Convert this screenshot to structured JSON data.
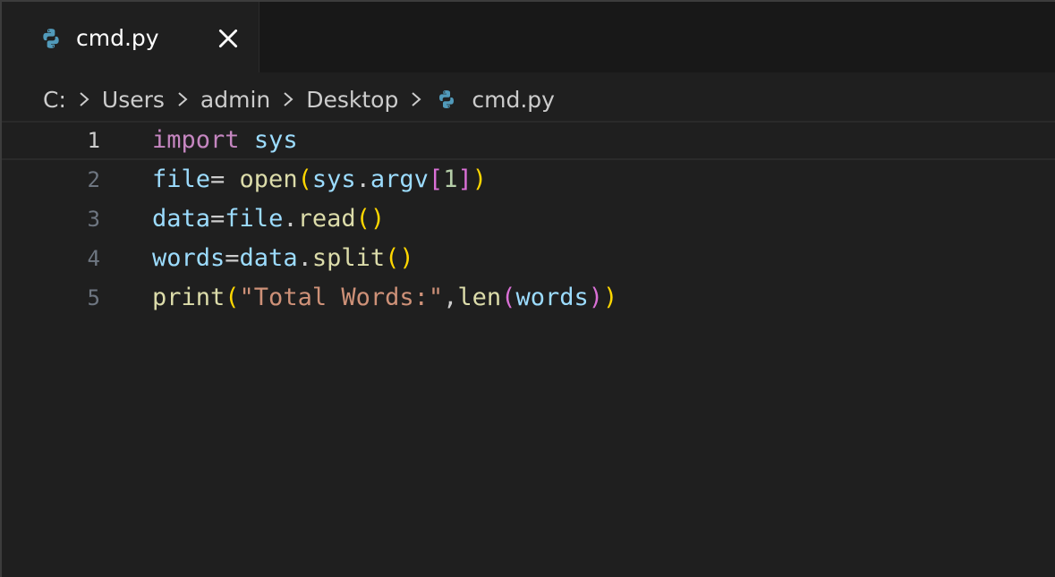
{
  "tab": {
    "label": "cmd.py",
    "icon": "python-file-icon",
    "close_icon": "close-icon"
  },
  "breadcrumb": {
    "items": [
      "C:",
      "Users",
      "admin",
      "Desktop",
      "cmd.py"
    ],
    "separator_icon": "chevron-right-icon",
    "file_icon": "python-file-icon"
  },
  "editor": {
    "current_line": 1,
    "lines": [
      {
        "number": "1",
        "tokens": [
          {
            "text": "import",
            "type": "keyword"
          },
          {
            "text": " ",
            "type": "plain"
          },
          {
            "text": "sys",
            "type": "variable"
          }
        ]
      },
      {
        "number": "2",
        "tokens": [
          {
            "text": "file",
            "type": "variable"
          },
          {
            "text": "= ",
            "type": "plain"
          },
          {
            "text": "open",
            "type": "function"
          },
          {
            "text": "(",
            "type": "bracket1"
          },
          {
            "text": "sys",
            "type": "variable"
          },
          {
            "text": ".",
            "type": "plain"
          },
          {
            "text": "argv",
            "type": "variable"
          },
          {
            "text": "[",
            "type": "bracket2"
          },
          {
            "text": "1",
            "type": "number"
          },
          {
            "text": "]",
            "type": "bracket2"
          },
          {
            "text": ")",
            "type": "bracket1"
          }
        ]
      },
      {
        "number": "3",
        "tokens": [
          {
            "text": "data",
            "type": "variable"
          },
          {
            "text": "=",
            "type": "plain"
          },
          {
            "text": "file",
            "type": "variable"
          },
          {
            "text": ".",
            "type": "plain"
          },
          {
            "text": "read",
            "type": "function"
          },
          {
            "text": "()",
            "type": "bracket1"
          }
        ]
      },
      {
        "number": "4",
        "tokens": [
          {
            "text": "words",
            "type": "variable"
          },
          {
            "text": "=",
            "type": "plain"
          },
          {
            "text": "data",
            "type": "variable"
          },
          {
            "text": ".",
            "type": "plain"
          },
          {
            "text": "split",
            "type": "function"
          },
          {
            "text": "()",
            "type": "bracket1"
          }
        ]
      },
      {
        "number": "5",
        "tokens": [
          {
            "text": "print",
            "type": "function"
          },
          {
            "text": "(",
            "type": "bracket1"
          },
          {
            "text": "\"Total Words:\"",
            "type": "string"
          },
          {
            "text": ",",
            "type": "plain"
          },
          {
            "text": "len",
            "type": "function"
          },
          {
            "text": "(",
            "type": "bracket2"
          },
          {
            "text": "words",
            "type": "variable"
          },
          {
            "text": ")",
            "type": "bracket2"
          },
          {
            "text": ")",
            "type": "bracket1"
          }
        ]
      }
    ]
  },
  "colors": {
    "background": "#1f1f1f",
    "tabbar_background": "#181818",
    "keyword": "#c586c0",
    "variable": "#9cdcfe",
    "function": "#dcdcaa",
    "number": "#b5cea8",
    "string": "#ce9178",
    "bracket1": "#ffd700",
    "bracket2": "#da70d6",
    "python_icon": "#519aba"
  }
}
